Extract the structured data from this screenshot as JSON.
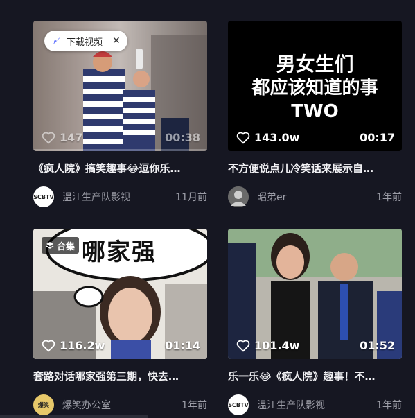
{
  "download_pill": {
    "label": "下载视频",
    "close": "✕"
  },
  "cards": [
    {
      "title": "《疯人院》搞笑趣事😂逗你乐…",
      "likes": "147",
      "duration": "00:38",
      "author": "温江生产队影视",
      "avatar_text": "SCBTV",
      "time": "11月前"
    },
    {
      "overlay_lines": [
        "男女生们",
        "都应该知道的事",
        "TWO"
      ],
      "title": "不方便说点儿冷笑话来展示自…",
      "likes": "143.0w",
      "duration": "00:17",
      "author": "昭弟er",
      "time": "1年前"
    },
    {
      "tag": "合集",
      "overlay_text": "哪家强",
      "title": "套路对话哪家强第三期，快去…",
      "likes": "116.2w",
      "duration": "01:14",
      "author": "爆笑办公室",
      "avatar_text": "爆笑",
      "time": "1年前"
    },
    {
      "title": "乐一乐😂《疯人院》趣事！不…",
      "likes": "101.4w",
      "duration": "01:52",
      "author": "温江生产队影视",
      "avatar_text": "SCBTV",
      "time": "1年前"
    }
  ]
}
